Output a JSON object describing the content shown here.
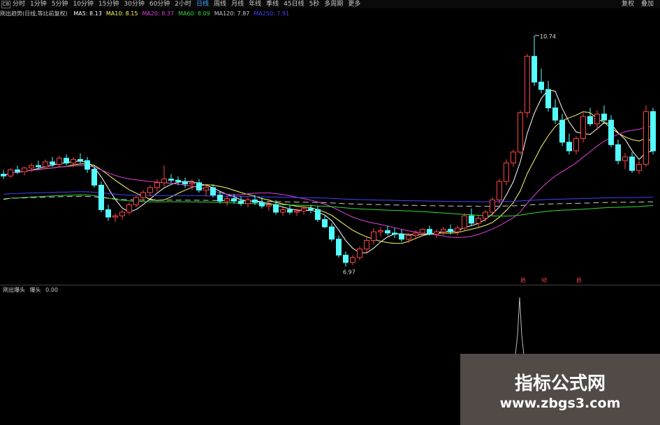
{
  "toolbar": {
    "checkbox": "CB",
    "periods": [
      "分时",
      "1分钟",
      "5分钟",
      "10分钟",
      "15分钟",
      "30分钟",
      "60分钟",
      "2小时",
      "日线",
      "周线",
      "月线",
      "年线",
      "季线",
      "45日线",
      "5秒",
      "多周期",
      "更多"
    ],
    "active_period": "日线",
    "restore": "复权",
    "overlay": "叠加"
  },
  "legend": {
    "title": "刚出趋势(日线,等比前复权)",
    "ma": [
      {
        "label": "MA5: 8.13",
        "color": "#ffffff"
      },
      {
        "label": "MA10: 8.15",
        "color": "#ffff66"
      },
      {
        "label": "MA20: 8.37",
        "color": "#e040e0"
      },
      {
        "label": "MA60: 8.09",
        "color": "#33dd33"
      },
      {
        "label": "MA120: 7.87",
        "color": "#cccccc"
      },
      {
        "label": "MA250: 7.91",
        "color": "#4444ff"
      }
    ]
  },
  "chart_data": {
    "type": "candlestick",
    "price_range": [
      6.7,
      11.0
    ],
    "high_label": "10.74",
    "low_label": "6.97",
    "candles": [
      [
        8.48,
        8.55,
        8.4,
        8.45
      ],
      [
        8.45,
        8.58,
        8.42,
        8.55
      ],
      [
        8.55,
        8.62,
        8.48,
        8.52
      ],
      [
        8.52,
        8.6,
        8.46,
        8.58
      ],
      [
        8.58,
        8.66,
        8.52,
        8.62
      ],
      [
        8.62,
        8.7,
        8.55,
        8.6
      ],
      [
        8.6,
        8.72,
        8.56,
        8.68
      ],
      [
        8.68,
        8.76,
        8.6,
        8.64
      ],
      [
        8.64,
        8.78,
        8.6,
        8.74
      ],
      [
        8.74,
        8.8,
        8.62,
        8.66
      ],
      [
        8.66,
        8.76,
        8.6,
        8.72
      ],
      [
        8.72,
        8.82,
        8.66,
        8.7
      ],
      [
        8.7,
        8.76,
        8.5,
        8.56
      ],
      [
        8.56,
        8.62,
        8.26,
        8.3
      ],
      [
        8.3,
        8.36,
        7.86,
        7.9
      ],
      [
        7.9,
        7.98,
        7.72,
        7.78
      ],
      [
        7.78,
        7.84,
        7.7,
        7.8
      ],
      [
        7.8,
        7.9,
        7.74,
        7.86
      ],
      [
        7.86,
        8.02,
        7.82,
        7.98
      ],
      [
        7.98,
        8.12,
        7.94,
        8.1
      ],
      [
        8.1,
        8.22,
        8.04,
        8.18
      ],
      [
        8.18,
        8.3,
        8.12,
        8.26
      ],
      [
        8.26,
        8.4,
        8.2,
        8.34
      ],
      [
        8.34,
        8.62,
        8.28,
        8.4
      ],
      [
        8.4,
        8.48,
        8.34,
        8.38
      ],
      [
        8.38,
        8.44,
        8.3,
        8.36
      ],
      [
        8.36,
        8.42,
        8.26,
        8.32
      ],
      [
        8.32,
        8.4,
        8.22,
        8.34
      ],
      [
        8.34,
        8.4,
        8.18,
        8.22
      ],
      [
        8.22,
        8.3,
        8.12,
        8.26
      ],
      [
        8.26,
        8.32,
        8.1,
        8.14
      ],
      [
        8.14,
        8.2,
        8.0,
        8.04
      ],
      [
        8.04,
        8.12,
        7.96,
        8.08
      ],
      [
        8.08,
        8.16,
        8.0,
        8.04
      ],
      [
        8.04,
        8.12,
        7.96,
        8.0
      ],
      [
        8.0,
        8.1,
        7.94,
        8.06
      ],
      [
        8.06,
        8.14,
        7.98,
        8.02
      ],
      [
        8.02,
        8.1,
        7.92,
        7.96
      ],
      [
        7.96,
        8.04,
        7.88,
        7.98
      ],
      [
        7.98,
        8.06,
        7.82,
        7.86
      ],
      [
        7.86,
        7.94,
        7.8,
        7.9
      ],
      [
        7.9,
        7.98,
        7.82,
        7.86
      ],
      [
        7.86,
        7.92,
        7.8,
        7.88
      ],
      [
        7.88,
        7.96,
        7.82,
        7.92
      ],
      [
        7.92,
        7.98,
        7.84,
        7.9
      ],
      [
        7.9,
        7.96,
        7.7,
        7.74
      ],
      [
        7.74,
        7.8,
        7.6,
        7.62
      ],
      [
        7.62,
        7.68,
        7.38,
        7.42
      ],
      [
        7.42,
        7.48,
        7.12,
        7.16
      ],
      [
        7.16,
        7.22,
        6.97,
        7.04
      ],
      [
        7.04,
        7.16,
        7.0,
        7.12
      ],
      [
        7.12,
        7.3,
        7.08,
        7.26
      ],
      [
        7.26,
        7.44,
        7.2,
        7.4
      ],
      [
        7.4,
        7.6,
        7.34,
        7.54
      ],
      [
        7.54,
        7.62,
        7.46,
        7.56
      ],
      [
        7.56,
        7.64,
        7.48,
        7.52
      ],
      [
        7.52,
        7.6,
        7.44,
        7.5
      ],
      [
        7.5,
        7.58,
        7.38,
        7.42
      ],
      [
        7.42,
        7.52,
        7.36,
        7.48
      ],
      [
        7.48,
        7.56,
        7.42,
        7.52
      ],
      [
        7.52,
        7.6,
        7.46,
        7.58
      ],
      [
        7.58,
        7.64,
        7.48,
        7.5
      ],
      [
        7.5,
        7.58,
        7.44,
        7.54
      ],
      [
        7.54,
        7.62,
        7.48,
        7.58
      ],
      [
        7.58,
        7.66,
        7.5,
        7.54
      ],
      [
        7.54,
        7.64,
        7.48,
        7.6
      ],
      [
        7.6,
        7.84,
        7.56,
        7.8
      ],
      [
        7.8,
        7.92,
        7.64,
        7.68
      ],
      [
        7.68,
        7.8,
        7.62,
        7.76
      ],
      [
        7.76,
        7.9,
        7.7,
        7.86
      ],
      [
        7.86,
        8.1,
        7.8,
        8.06
      ],
      [
        8.06,
        8.4,
        8.0,
        8.36
      ],
      [
        8.36,
        8.72,
        8.3,
        8.66
      ],
      [
        8.66,
        8.88,
        8.6,
        8.84
      ],
      [
        8.84,
        9.52,
        8.8,
        9.48
      ],
      [
        9.48,
        10.44,
        9.4,
        10.4
      ],
      [
        10.4,
        10.74,
        9.92,
        9.98
      ],
      [
        9.98,
        10.2,
        9.8,
        9.86
      ],
      [
        9.86,
        10.0,
        9.5,
        9.56
      ],
      [
        9.56,
        9.7,
        9.3,
        9.36
      ],
      [
        9.36,
        9.46,
        8.94,
        9.0
      ],
      [
        9.0,
        9.14,
        8.8,
        8.86
      ],
      [
        8.86,
        9.1,
        8.8,
        9.06
      ],
      [
        9.06,
        9.48,
        9.0,
        9.42
      ],
      [
        9.42,
        9.56,
        9.26,
        9.3
      ],
      [
        9.3,
        9.52,
        9.2,
        9.46
      ],
      [
        9.46,
        9.6,
        9.3,
        9.36
      ],
      [
        9.36,
        9.44,
        8.92,
        8.96
      ],
      [
        8.96,
        9.04,
        8.64,
        8.7
      ],
      [
        8.7,
        8.82,
        8.56,
        8.76
      ],
      [
        8.76,
        8.84,
        8.5,
        8.54
      ],
      [
        8.54,
        8.7,
        8.48,
        8.64
      ],
      [
        8.64,
        9.6,
        8.6,
        9.5
      ],
      [
        9.5,
        9.56,
        8.8,
        8.86
      ]
    ],
    "series": [
      {
        "name": "MA5",
        "color": "#ffffff"
      },
      {
        "name": "MA10",
        "color": "#ffff66"
      },
      {
        "name": "MA20",
        "color": "#e040e0"
      },
      {
        "name": "MA60",
        "color": "#33dd33"
      },
      {
        "name": "MA120",
        "color": "#cccccc"
      },
      {
        "name": "MA250",
        "color": "#4444ff"
      }
    ],
    "signals": [
      "启",
      "动",
      "启"
    ]
  },
  "sub_indicator": {
    "label": "刚出爆头",
    "label2": "爆头",
    "value": "0.00"
  },
  "watermark": {
    "title": "指标公式网",
    "url": "www.zbgs3.com"
  }
}
